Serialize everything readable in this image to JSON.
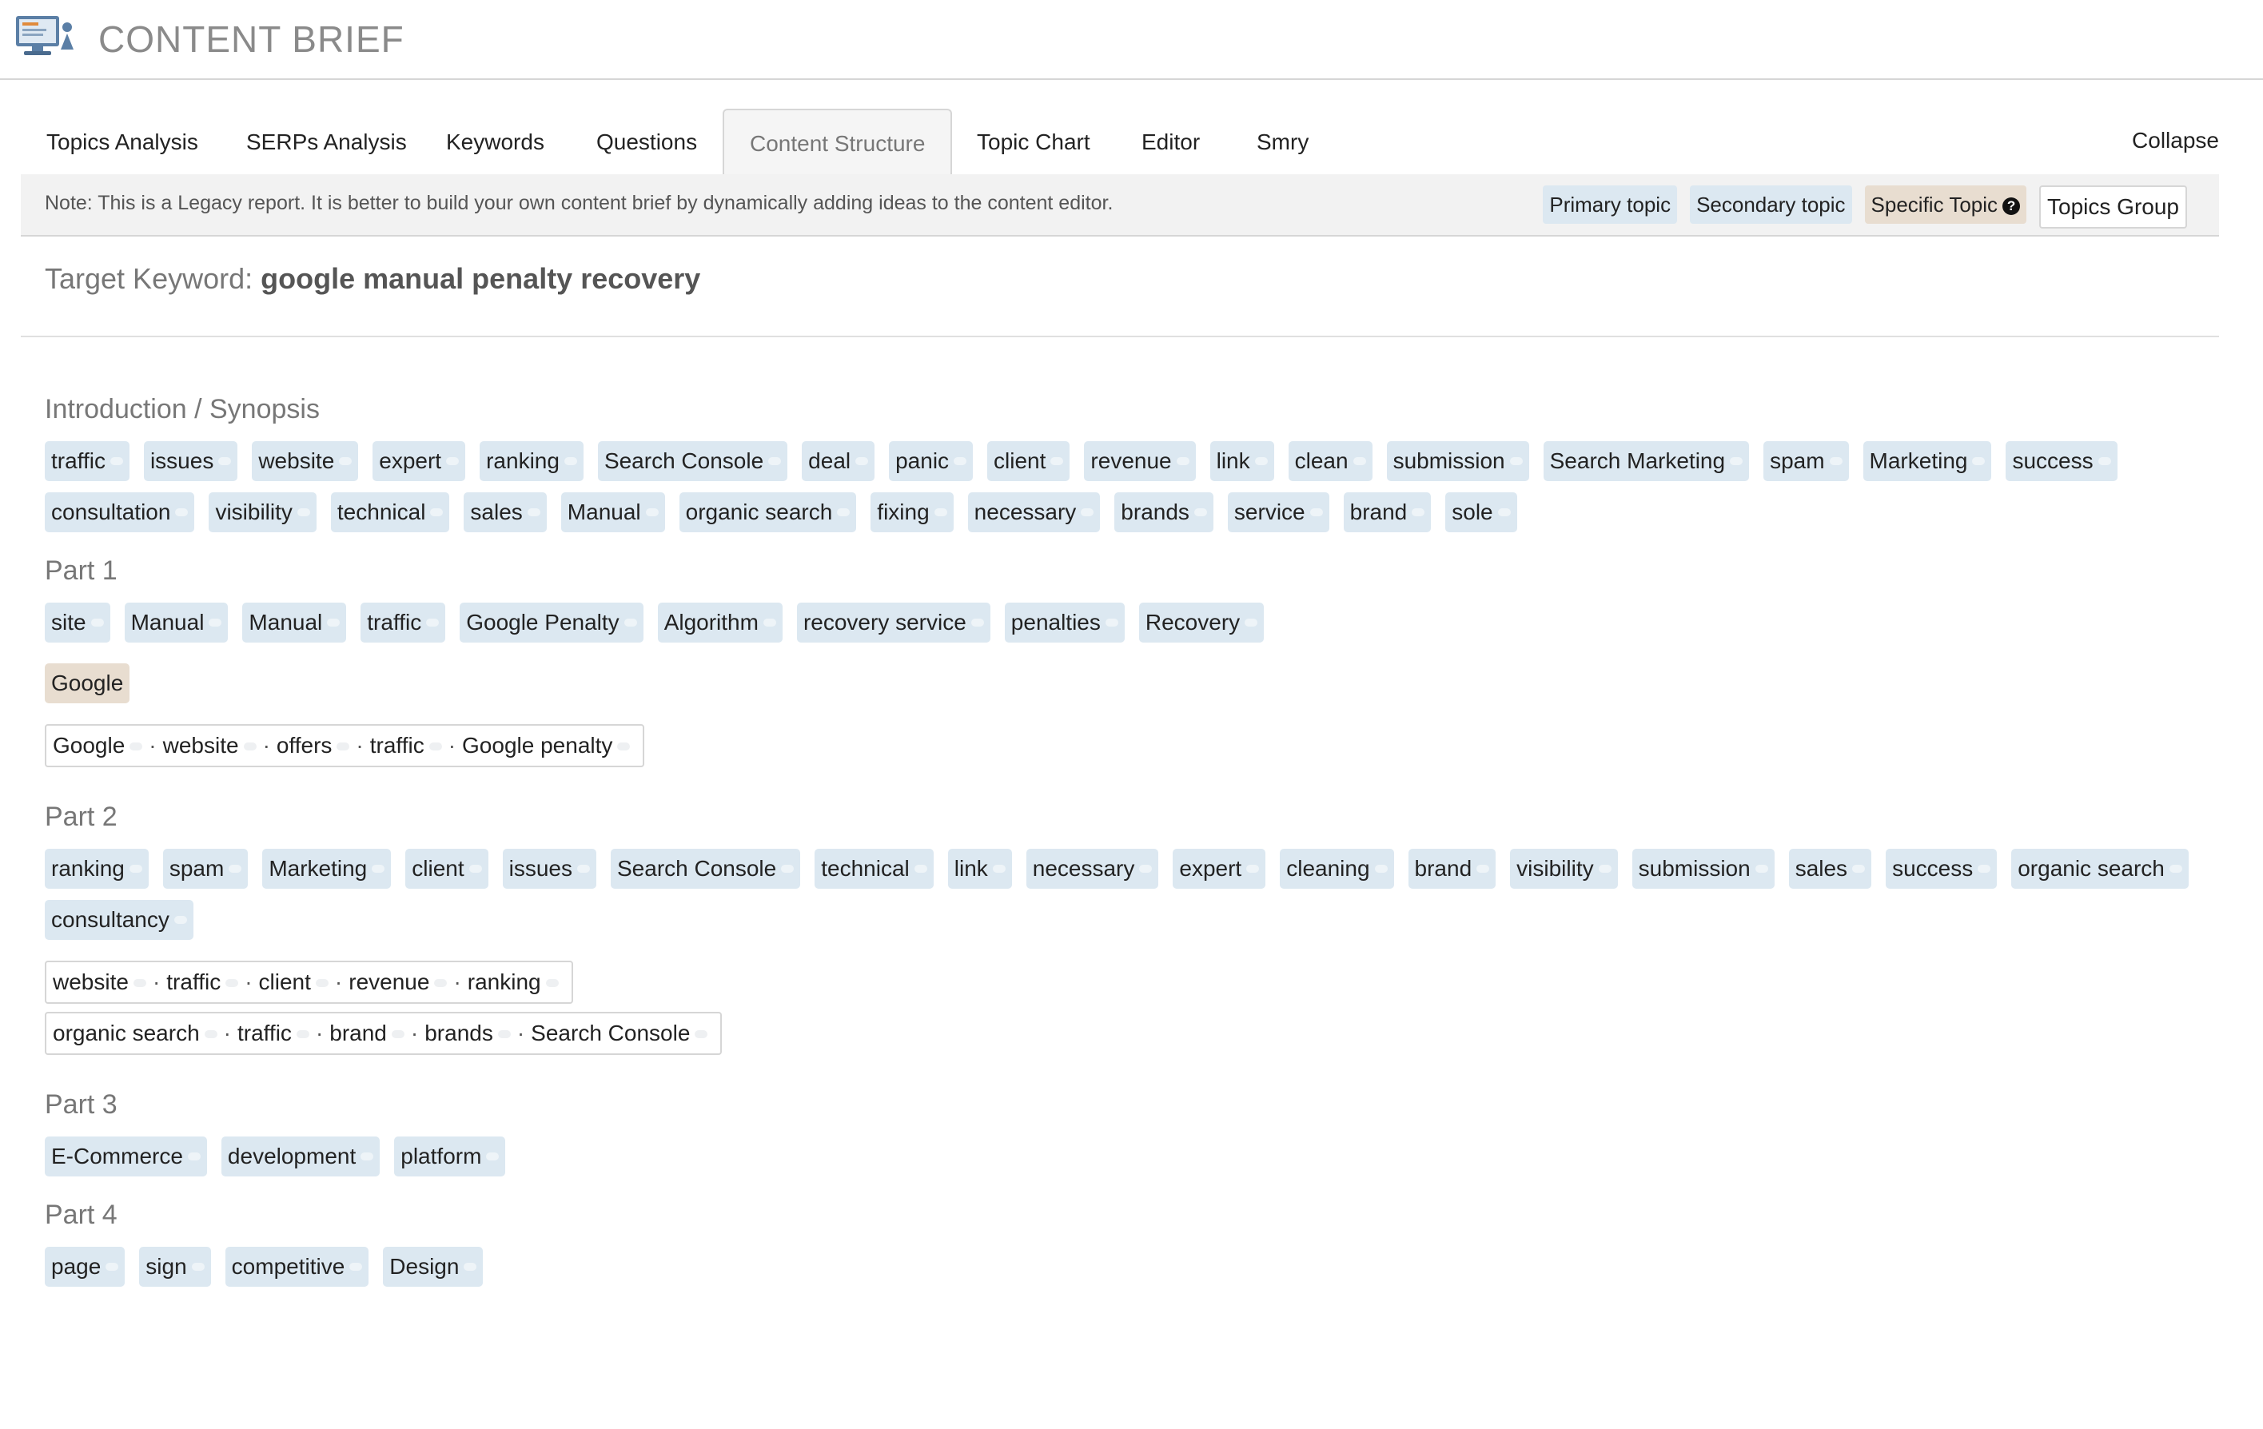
{
  "app": {
    "title": "CONTENT BRIEF"
  },
  "tabs": [
    {
      "label": "Topics Analysis"
    },
    {
      "label": "SERPs Analysis"
    },
    {
      "label": "Keywords"
    },
    {
      "label": "Questions"
    },
    {
      "label": "Content Structure",
      "active": true
    },
    {
      "label": "Topic Chart"
    },
    {
      "label": "Editor"
    },
    {
      "label": "Smry"
    }
  ],
  "collapse_label": "Collapse",
  "note": "Note: This is a Legacy report. It is better to build your own content brief by dynamically adding ideas to the content editor.",
  "legend": {
    "primary": "Primary topic",
    "secondary": "Secondary topic",
    "specific": "Specific Topic",
    "group": "Topics Group"
  },
  "target": {
    "label": "Target Keyword:",
    "keyword": "google manual penalty recovery"
  },
  "colors": {
    "topic_chip": "#dce8f1",
    "specific_chip": "#e8ddd0",
    "border": "#d6d6d6"
  },
  "sections": [
    {
      "title": "Introduction / Synopsis",
      "topics": [
        "traffic",
        "issues",
        "website",
        "expert",
        "ranking",
        "Search Console",
        "deal",
        "panic",
        "client",
        "revenue",
        "link",
        "clean",
        "submission",
        "Search Marketing",
        "spam",
        "Marketing",
        "success",
        "consultation",
        "visibility",
        "technical",
        "sales",
        "Manual",
        "organic search",
        "fixing",
        "necessary",
        "brands",
        "service",
        "brand",
        "sole"
      ],
      "specific": [],
      "groups": []
    },
    {
      "title": "Part 1",
      "topics": [
        "site",
        "Manual",
        "Manual",
        "traffic",
        "Google Penalty",
        "Algorithm",
        "recovery service",
        "penalties",
        "Recovery"
      ],
      "specific": [
        "Google"
      ],
      "groups": [
        [
          "Google",
          "website",
          "offers",
          "traffic",
          "Google penalty"
        ]
      ]
    },
    {
      "title": "Part 2",
      "topics": [
        "ranking",
        "spam",
        "Marketing",
        "client",
        "issues",
        "Search Console",
        "technical",
        "link",
        "necessary",
        "expert",
        "cleaning",
        "brand",
        "visibility",
        "submission",
        "sales",
        "success",
        "organic search",
        "consultancy"
      ],
      "specific": [],
      "groups": [
        [
          "website",
          "traffic",
          "client",
          "revenue",
          "ranking"
        ],
        [
          "organic search",
          "traffic",
          "brand",
          "brands",
          "Search Console"
        ]
      ]
    },
    {
      "title": "Part 3",
      "topics": [
        "E-Commerce",
        "development",
        "platform"
      ],
      "specific": [],
      "groups": []
    },
    {
      "title": "Part 4",
      "topics": [
        "page",
        "sign",
        "competitive",
        "Design"
      ],
      "specific": [],
      "groups": []
    }
  ]
}
